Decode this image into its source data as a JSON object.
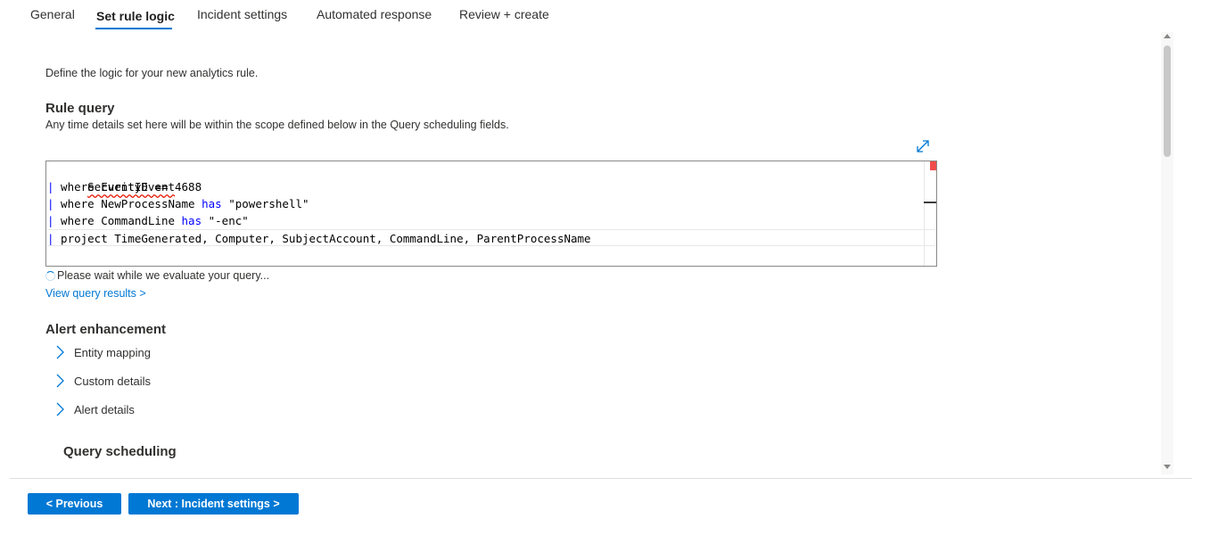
{
  "tabs": [
    {
      "label": "General"
    },
    {
      "label": "Set rule logic",
      "active": true
    },
    {
      "label": "Incident settings"
    },
    {
      "label": "Automated response"
    },
    {
      "label": "Review + create"
    }
  ],
  "intro": "Define the logic for your new analytics rule.",
  "rule_query": {
    "title": "Rule query",
    "description": "Any time details set here will be within the scope defined below in the Query scheduling fields.",
    "expand_icon": "expand-diagonal-icon",
    "lines": {
      "l1": "SecurityEvent",
      "l2_pipe": "|",
      "l2_text": " where EventID == 4688",
      "l3_pipe": "|",
      "l3_a": " where NewProcessName ",
      "l3_kw": "has",
      "l3_b": " \"powershell\"",
      "l4_pipe": "|",
      "l4_a": " where CommandLine ",
      "l4_kw": "has",
      "l4_b": " \"-enc\"",
      "l5_pipe": "|",
      "l5_text": " project TimeGenerated, Computer, SubjectAccount, CommandLine, ParentProcessName"
    },
    "status_text": "Please wait while we evaluate your query...",
    "view_results_link": "View query results >"
  },
  "alert_enhancement": {
    "title": "Alert enhancement",
    "items": [
      {
        "label": "Entity mapping"
      },
      {
        "label": "Custom details"
      },
      {
        "label": "Alert details"
      }
    ]
  },
  "query_scheduling": {
    "title": "Query scheduling"
  },
  "footer": {
    "previous_label": "< Previous",
    "next_label": "Next : Incident settings >"
  },
  "colors": {
    "accent": "#0078d4",
    "keyword": "#0000ff",
    "error": "#e51400"
  }
}
